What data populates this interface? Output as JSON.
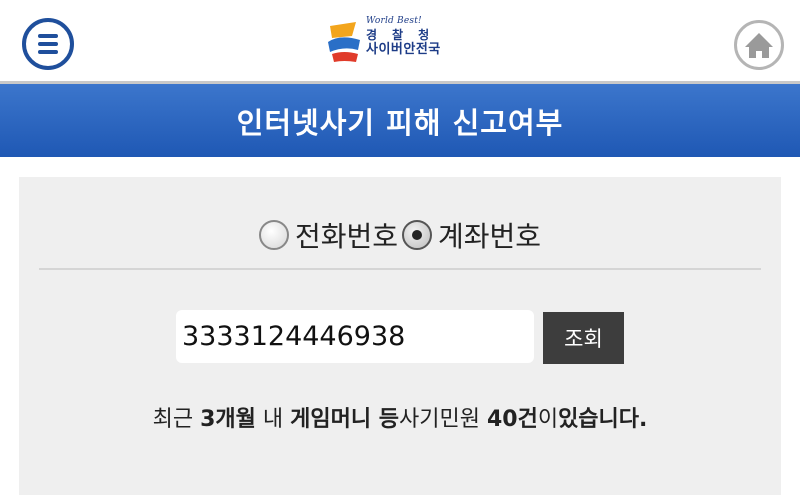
{
  "header": {
    "menu_icon": "hamburger-menu-icon",
    "home_icon": "home-icon",
    "logo": {
      "tagline": "World Best!",
      "org": "경찰청",
      "unit": "사이버안전국"
    }
  },
  "title": "인터넷사기 피해 신고여부",
  "search_type": {
    "options": [
      {
        "label": "전화번호",
        "checked": false
      },
      {
        "label": "계좌번호",
        "checked": true
      }
    ]
  },
  "search": {
    "value": "3333124446938",
    "button_label": "조회"
  },
  "result": {
    "prefix": "최근 ",
    "period": "3개월",
    "mid1": " 내 ",
    "category": "게임머니 등",
    "mid2": "사기민원 ",
    "count": "40건",
    "mid3": "이",
    "suffix": "있습니다."
  },
  "colors": {
    "accent_blue": "#2a62bf",
    "menu_blue": "#1f4f9c",
    "button_dark": "#3d3d3d",
    "panel_gray": "#efefef"
  }
}
